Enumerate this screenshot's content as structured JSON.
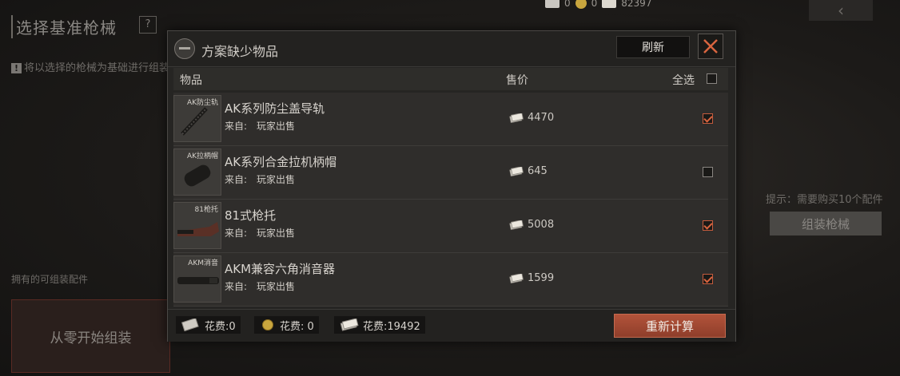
{
  "background": {
    "page_title": "选择基准枪械",
    "help_label": "?",
    "note_mark": "!",
    "note": "将以选择的枪械为基础进行组装",
    "currency": [
      "0",
      "0",
      "82397"
    ],
    "owned_parts_label": "拥有的可组装配件",
    "scratch_button": "从零开始组装",
    "hint": "提示：需要购买10个配件",
    "assemble_button": "组装枪械",
    "back_icon": "‹"
  },
  "modal": {
    "title": "方案缺少物品",
    "refresh_label": "刷新",
    "columns": {
      "item": "物品",
      "price": "售价",
      "select_all": "全选"
    },
    "select_all_checked": false,
    "items": [
      {
        "thumb_label": "AK防尘轨",
        "name": "AK系列防尘盖导轨",
        "source_label": "来自:",
        "source": "玩家出售",
        "price": "4470",
        "checked": true,
        "thumb_icon": "rail-icon"
      },
      {
        "thumb_label": "AK拉柄帽",
        "name": "AK系列合金拉机柄帽",
        "source_label": "来自:",
        "source": "玩家出售",
        "price": "645",
        "checked": false,
        "thumb_icon": "handle-cap-icon"
      },
      {
        "thumb_label": "81枪托",
        "name": "81式枪托",
        "source_label": "来自:",
        "source": "玩家出售",
        "price": "5008",
        "checked": true,
        "thumb_icon": "stock-icon"
      },
      {
        "thumb_label": "AKM消音",
        "name": "AKM兼容六角消音器",
        "source_label": "来自:",
        "source": "玩家出售",
        "price": "1599",
        "checked": true,
        "thumb_icon": "suppressor-icon"
      }
    ],
    "footer": {
      "costs": [
        "花费:0",
        "花费: 0",
        "花费:19492"
      ],
      "recalc_label": "重新计算"
    }
  },
  "colors": {
    "accent": "#b2533a",
    "check": "#d9653f"
  }
}
